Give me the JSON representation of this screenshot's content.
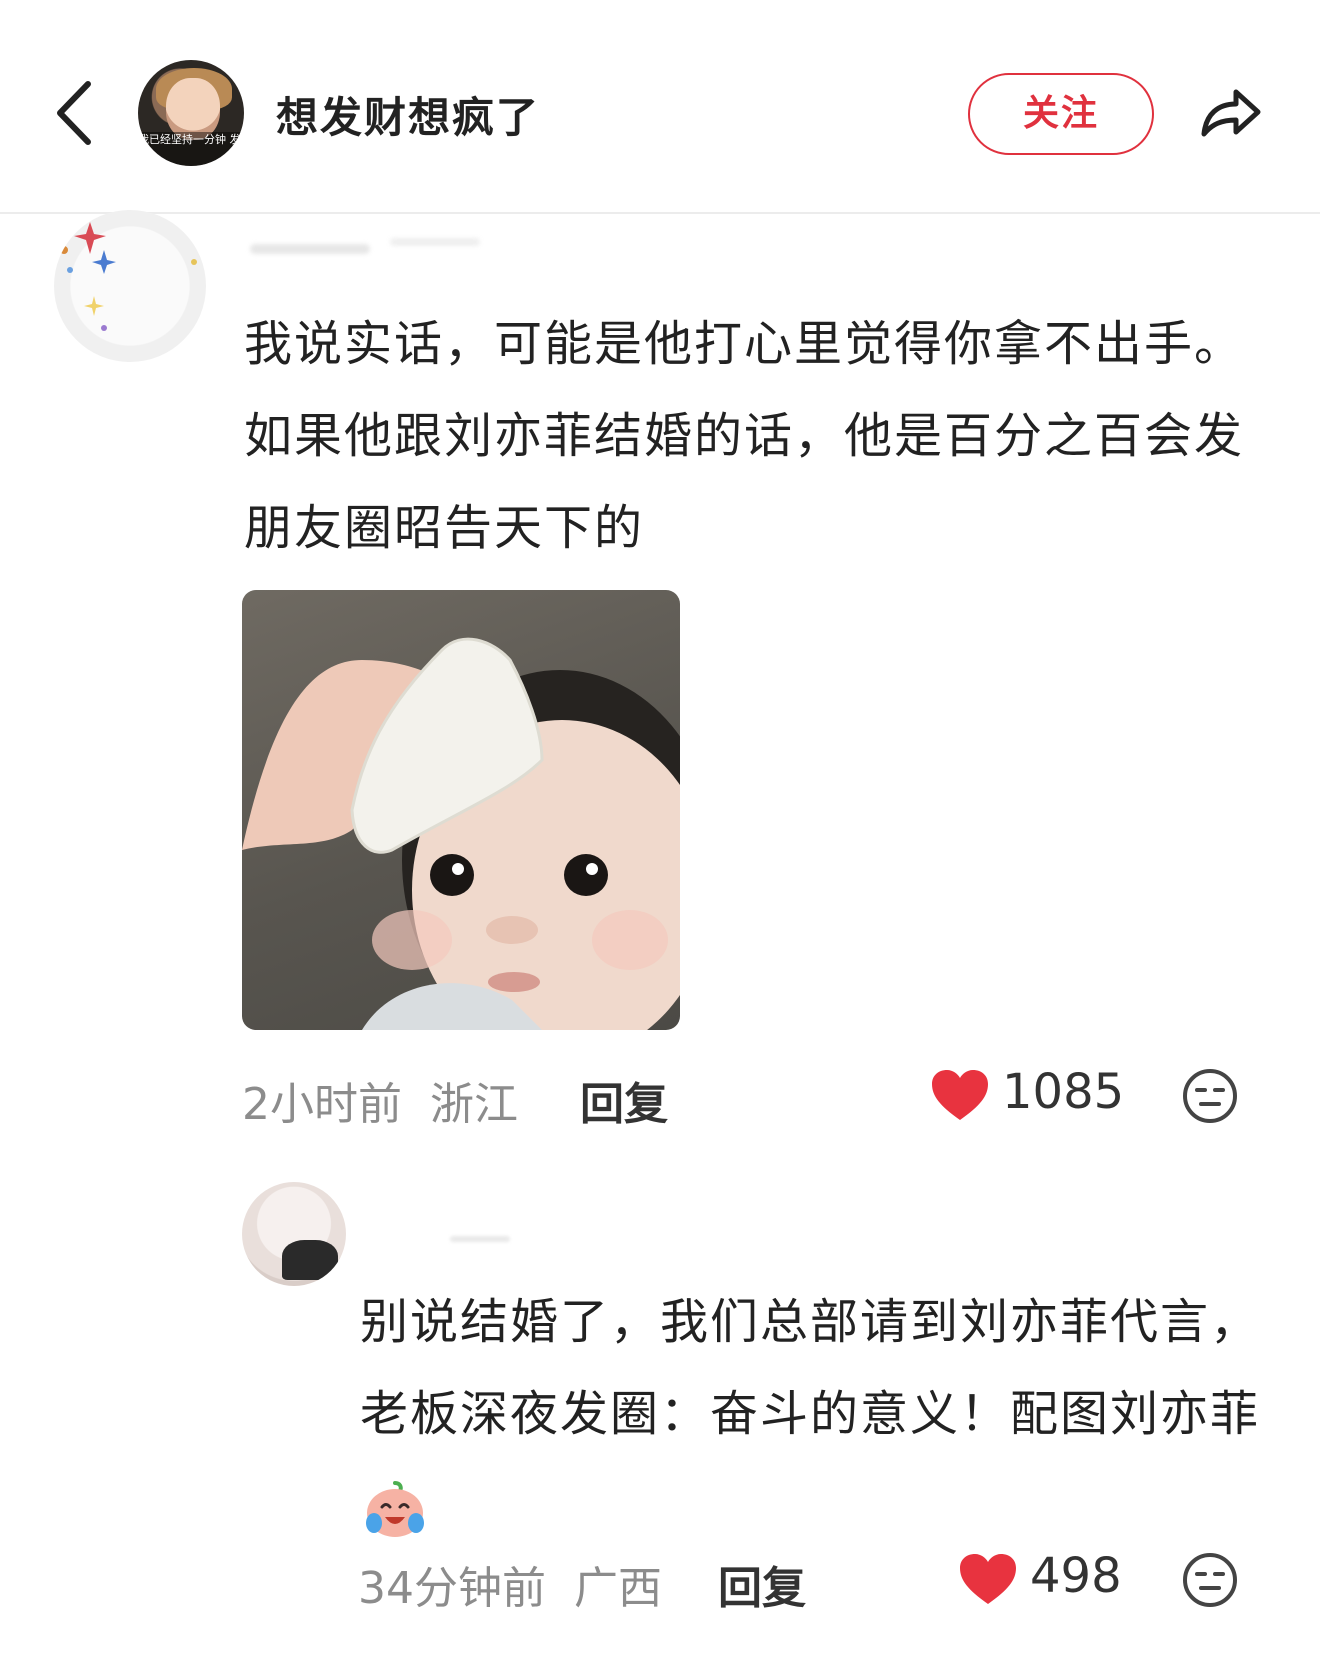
{
  "header": {
    "title": "想发财想疯了",
    "follow_label": "关注",
    "avatar_caption": "我已经坚持一分钟 发疯了！",
    "icons": {
      "back": "chevron-left-icon",
      "share": "share-arrow-icon"
    }
  },
  "comments": [
    {
      "text": "我说实话，可能是他打心里觉得你拿不出手。如果他跟刘亦菲结婚的话，他是百分之百会发朋友圈昭告天下的",
      "has_image": true,
      "time": "2小时前",
      "location": "浙江",
      "reply_label": "回复",
      "likes": "1085"
    },
    {
      "text": "别说结婚了，我们总部请到刘亦菲代言，老板深夜发圈：奋斗的意义！配图刘亦菲",
      "time": "34分钟前",
      "location": "广西",
      "reply_label": "回复",
      "likes": "498"
    }
  ],
  "colors": {
    "accent": "#e0313e",
    "like_heart": "#e8333f",
    "meta_text": "#8c8c8c",
    "body_text": "#222222"
  }
}
